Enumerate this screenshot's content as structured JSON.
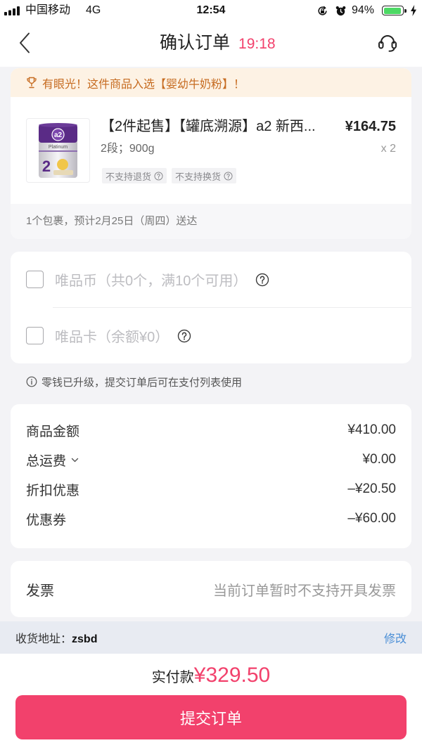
{
  "colors": {
    "accent": "#f2416c",
    "banner_bg": "#fdf2e4",
    "banner_text": "#c66b20",
    "link": "#4a8ed6",
    "battery": "#4cd964",
    "address_bg": "#e8ebf2",
    "page_bg": "#f3f3f6"
  },
  "status_bar": {
    "carrier": "中国移动",
    "network": "4G",
    "time": "12:54",
    "battery_text": "94%",
    "battery_level": 0.94,
    "icons": [
      "signal-icon",
      "rotation-lock-icon",
      "alarm-icon",
      "battery-icon",
      "charging-icon"
    ]
  },
  "nav": {
    "title": "确认订单",
    "countdown": "19:18",
    "icons": {
      "back": "chevron-left-icon",
      "service": "headset-icon"
    }
  },
  "banner": {
    "icon": "trophy-icon",
    "text": "有眼光！这件商品入选【婴幼牛奶粉】！"
  },
  "product": {
    "image": {
      "logo": "a2",
      "label": "Platinum",
      "stage": "2"
    },
    "title": "【2件起售】【罐底溯源】a2 新西...",
    "price": "¥164.75",
    "spec": "2段；900g",
    "quantity": "x 2",
    "tags": [
      {
        "label": "不支持退货",
        "icon": "help-icon"
      },
      {
        "label": "不支持换货",
        "icon": "help-icon"
      }
    ]
  },
  "delivery": {
    "text": "1个包裹，预计2月25日（周四）送达"
  },
  "payment_options": [
    {
      "label": "唯品币（共0个，满10个可用）",
      "checked": false,
      "icon": "help-icon"
    },
    {
      "label": "唯品卡（余额¥0）",
      "checked": false,
      "icon": "help-icon"
    }
  ],
  "notice": {
    "icon": "info-icon",
    "text": "零钱已升级，提交订单后可在支付列表使用"
  },
  "summary": [
    {
      "label": "商品金额",
      "value": "¥410.00"
    },
    {
      "label": "总运费",
      "value": "¥0.00",
      "icon": "chevron-down-icon"
    },
    {
      "label": "折扣优惠",
      "value": "–¥20.50"
    },
    {
      "label": "优惠券",
      "value": "–¥60.00"
    }
  ],
  "invoice": {
    "label": "发票",
    "value": "当前订单暂时不支持开具发票"
  },
  "address": {
    "label": "收货地址：",
    "name": "zsbd",
    "edit": "修改"
  },
  "footer": {
    "total_label": "实付款",
    "total_value": "¥329.50",
    "submit": "提交订单"
  }
}
